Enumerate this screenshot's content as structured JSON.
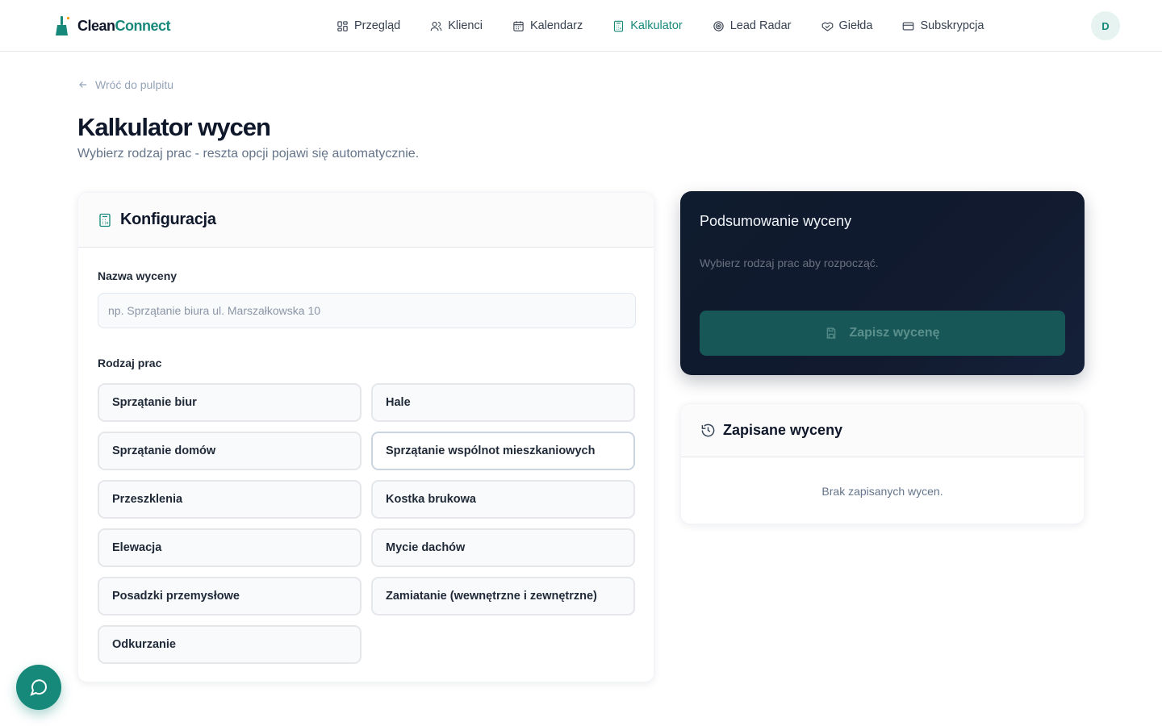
{
  "brand": {
    "name_part1": "Clean",
    "name_part2": "Connect",
    "accent": "#16897a"
  },
  "nav": {
    "items": [
      {
        "label": "Przegląd",
        "icon": "layout-grid-icon",
        "active": false
      },
      {
        "label": "Klienci",
        "icon": "users-icon",
        "active": false
      },
      {
        "label": "Kalendarz",
        "icon": "calendar-icon",
        "active": false
      },
      {
        "label": "Kalkulator",
        "icon": "calculator-icon",
        "active": true
      },
      {
        "label": "Lead Radar",
        "icon": "radar-icon",
        "active": false
      },
      {
        "label": "Giełda",
        "icon": "handshake-icon",
        "active": false
      },
      {
        "label": "Subskrypcja",
        "icon": "credit-card-icon",
        "active": false
      }
    ],
    "avatar_initial": "D"
  },
  "page": {
    "back_label": "Wróć do pulpitu",
    "title": "Kalkulator wycen",
    "subtitle": "Wybierz rodzaj prac - reszta opcji pojawi się automatycznie."
  },
  "config": {
    "title": "Konfiguracja",
    "name_label": "Nazwa wyceny",
    "name_value": "",
    "name_placeholder": "np. Sprzątanie biura ul. Marszałkowska 10",
    "work_label": "Rodzaj prac",
    "work_types": [
      "Sprzątanie biur",
      "Hale",
      "Sprzątanie domów",
      "Sprzątanie wspólnot mieszkaniowych",
      "Przeszklenia",
      "Kostka brukowa",
      "Elewacja",
      "Mycie dachów",
      "Posadzki przemysłowe",
      "Zamiatanie (wewnętrzne i zewnętrzne)",
      "Odkurzanie"
    ]
  },
  "summary": {
    "title": "Podsumowanie wyceny",
    "hint": "Wybierz rodzaj prac aby rozpocząć.",
    "save_label": "Zapisz wycenę"
  },
  "saved": {
    "title": "Zapisane wyceny",
    "empty": "Brak zapisanych wycen."
  },
  "chat": {
    "icon": "message-circle-icon"
  }
}
